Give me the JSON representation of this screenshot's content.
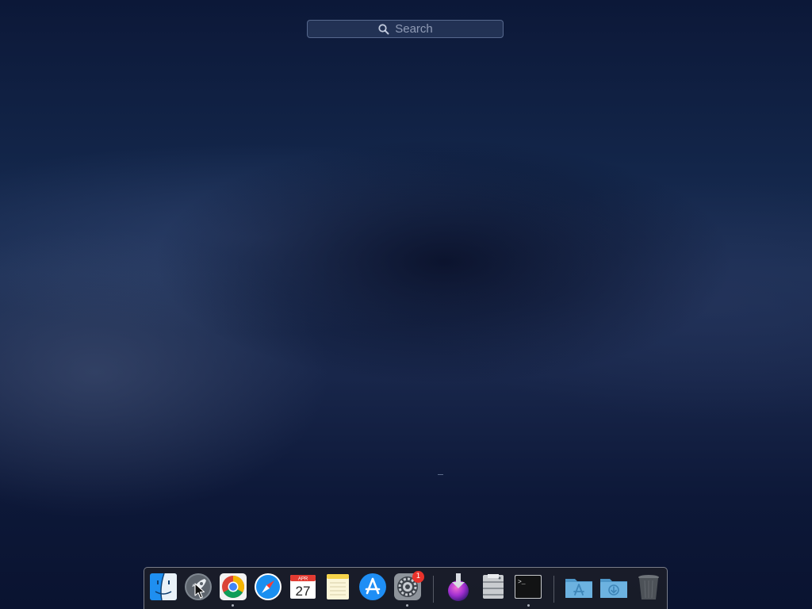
{
  "search": {
    "placeholder": "Search",
    "icon": "magnifier-icon"
  },
  "dock": {
    "items": [
      {
        "name": "Finder",
        "icon": "finder-icon",
        "running": false
      },
      {
        "name": "Launchpad",
        "icon": "launchpad-rocket-icon",
        "running": true
      },
      {
        "name": "Google Chrome",
        "icon": "chrome-icon",
        "running": false
      },
      {
        "name": "Safari",
        "icon": "safari-compass-icon",
        "running": false
      },
      {
        "name": "Calendar",
        "icon": "calendar-icon",
        "month": "APR",
        "day": "27",
        "running": false
      },
      {
        "name": "Notes",
        "icon": "notes-icon",
        "running": false
      },
      {
        "name": "App Store",
        "icon": "app-store-icon",
        "running": false
      },
      {
        "name": "System Preferences",
        "icon": "gear-icon",
        "badge": "1",
        "running": true
      },
      {
        "name": "Installer",
        "icon": "installer-download-icon",
        "running": false
      },
      {
        "name": "Utility",
        "icon": "disk-utility-icon",
        "running": false
      },
      {
        "name": "Terminal",
        "icon": "terminal-icon",
        "prompt": ">_",
        "running": true
      },
      {
        "name": "Applications",
        "icon": "applications-folder-icon",
        "running": false
      },
      {
        "name": "Downloads",
        "icon": "downloads-folder-icon",
        "running": false
      },
      {
        "name": "Trash",
        "icon": "trash-icon",
        "running": false
      }
    ]
  },
  "colors": {
    "badge": "#e8322b",
    "folder": "#5ba7d6",
    "app_store": "#1e8ef5",
    "chrome_red": "#db4437",
    "chrome_yellow": "#f4b400",
    "chrome_green": "#0f9d58",
    "chrome_blue": "#4285f4"
  }
}
